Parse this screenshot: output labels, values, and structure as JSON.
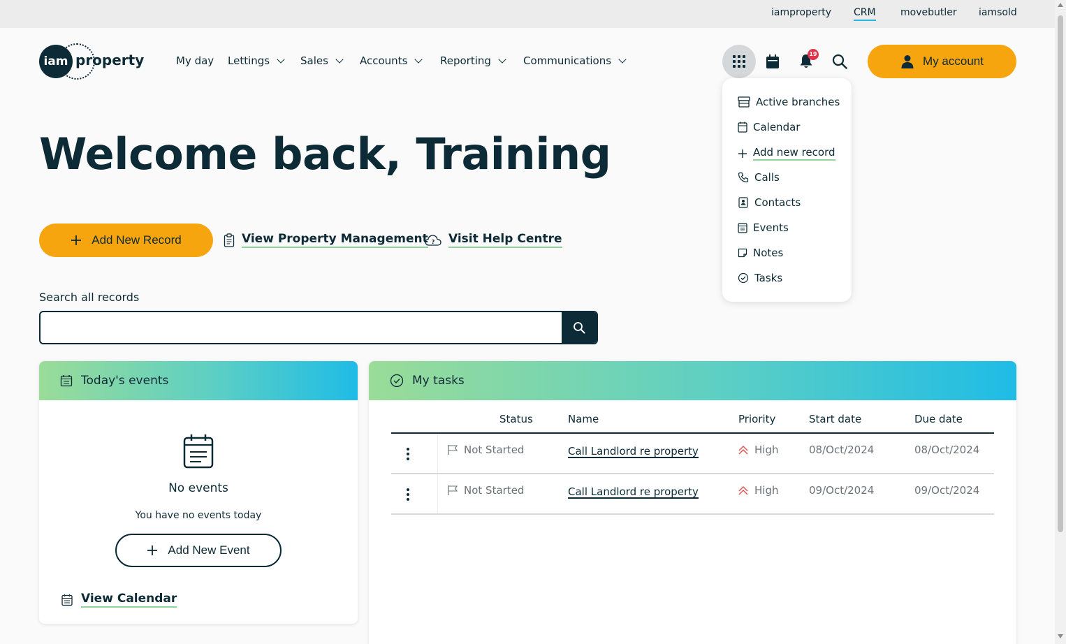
{
  "topbar": {
    "links": [
      {
        "label": "iamproperty",
        "active": false
      },
      {
        "label": "CRM",
        "active": true
      },
      {
        "label": "movebutler",
        "active": false
      },
      {
        "label": "iamsold",
        "active": false
      }
    ]
  },
  "brand": {
    "logo_mark": "iam",
    "logo_word": "property"
  },
  "nav": {
    "items": [
      {
        "label": "My day",
        "has_dropdown": false
      },
      {
        "label": "Lettings",
        "has_dropdown": true
      },
      {
        "label": "Sales",
        "has_dropdown": true
      },
      {
        "label": "Accounts",
        "has_dropdown": true
      },
      {
        "label": "Reporting",
        "has_dropdown": true
      },
      {
        "label": "Communications",
        "has_dropdown": true
      }
    ]
  },
  "header": {
    "notification_count": "19",
    "my_account_label": "My account",
    "icons": [
      "grid-icon",
      "calendar-icon",
      "bell-icon",
      "search-icon",
      "user-icon"
    ]
  },
  "quick_menu": {
    "items": [
      {
        "label": "Active branches",
        "icon": "branches-icon"
      },
      {
        "label": "Calendar",
        "icon": "calendar-icon"
      },
      {
        "label": "Add new record",
        "icon": "plus-icon"
      },
      {
        "label": "Calls",
        "icon": "phone-icon"
      },
      {
        "label": "Contacts",
        "icon": "contact-card-icon"
      },
      {
        "label": "Events",
        "icon": "events-icon"
      },
      {
        "label": "Notes",
        "icon": "note-icon"
      },
      {
        "label": "Tasks",
        "icon": "check-circle-icon"
      }
    ]
  },
  "welcome": {
    "title": "Welcome back, Training"
  },
  "actions": {
    "add_record": "Add New Record",
    "view_property_management": "View Property Management",
    "visit_help_centre": "Visit Help Centre"
  },
  "search": {
    "label": "Search all records",
    "value": "",
    "placeholder": ""
  },
  "events_card": {
    "title": "Today's events",
    "empty_title": "No events",
    "empty_message": "You have no events today",
    "add_event": "Add New Event",
    "view_calendar": "View Calendar"
  },
  "tasks_card": {
    "title": "My tasks",
    "columns": [
      "Status",
      "Name",
      "Priority",
      "Start date",
      "Due date"
    ],
    "rows": [
      {
        "status": "Not Started",
        "name": "Call Landlord re property",
        "priority": "High",
        "start_date": "08/Oct/2024",
        "due_date": "08/Oct/2024"
      },
      {
        "status": "Not Started",
        "name": "Call Landlord re property",
        "priority": "High",
        "start_date": "09/Oct/2024",
        "due_date": "09/Oct/2024"
      }
    ]
  },
  "colors": {
    "brand_dark": "#0d2b36",
    "accent_orange": "#f7a50f",
    "link_underline": "#8fd49a",
    "badge_red": "#e0344a",
    "priority_high": "#e05555"
  }
}
